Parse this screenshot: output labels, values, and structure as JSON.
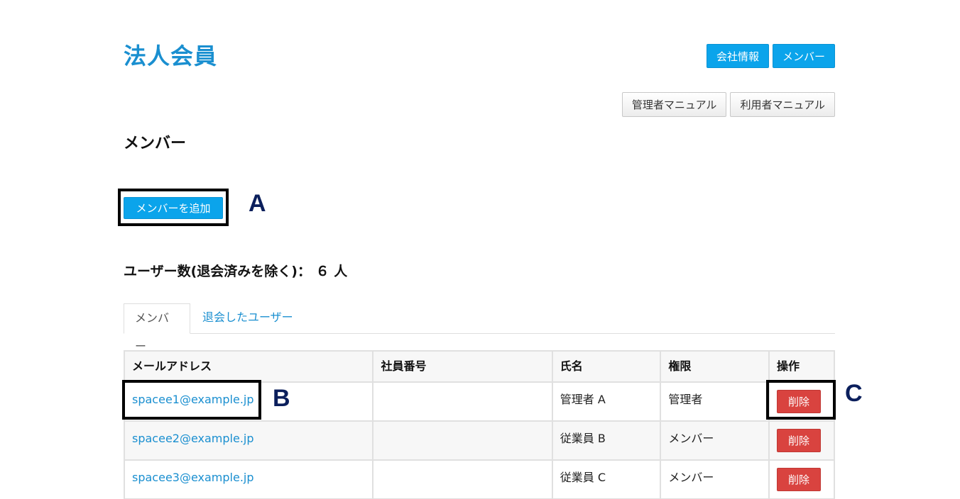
{
  "brand": "法人会員",
  "top_nav": {
    "company_info": "会社情報",
    "members": "メンバー"
  },
  "manuals": {
    "admin_manual": "管理者マニュアル",
    "user_manual": "利用者マニュアル"
  },
  "section_title": "メンバー",
  "add_member_button": "メンバーを追加",
  "annotations": {
    "a": "A",
    "b": "B",
    "c": "C"
  },
  "user_count_label": "ユーザー数(退会済みを除く)： ６ 人",
  "tabs": {
    "members": "メンバー",
    "withdrawn": "退会したユーザー"
  },
  "table": {
    "headers": {
      "email": "メールアドレス",
      "employee_no": "社員番号",
      "name": "氏名",
      "role": "権限",
      "action": "操作"
    },
    "rows": [
      {
        "email": "spacee1@example.jp",
        "employee_no": "",
        "name": "管理者 A",
        "role": "管理者",
        "action": "削除"
      },
      {
        "email": "spacee2@example.jp",
        "employee_no": "",
        "name": "従業員 B",
        "role": "メンバー",
        "action": "削除"
      },
      {
        "email": "spacee3@example.jp",
        "employee_no": "",
        "name": "従業員 C",
        "role": "メンバー",
        "action": "削除"
      }
    ]
  },
  "colors": {
    "primary": "#0ba4eb",
    "link": "#1a8fd0",
    "danger": "#d9433f",
    "annotation": "#0b1f5c"
  }
}
